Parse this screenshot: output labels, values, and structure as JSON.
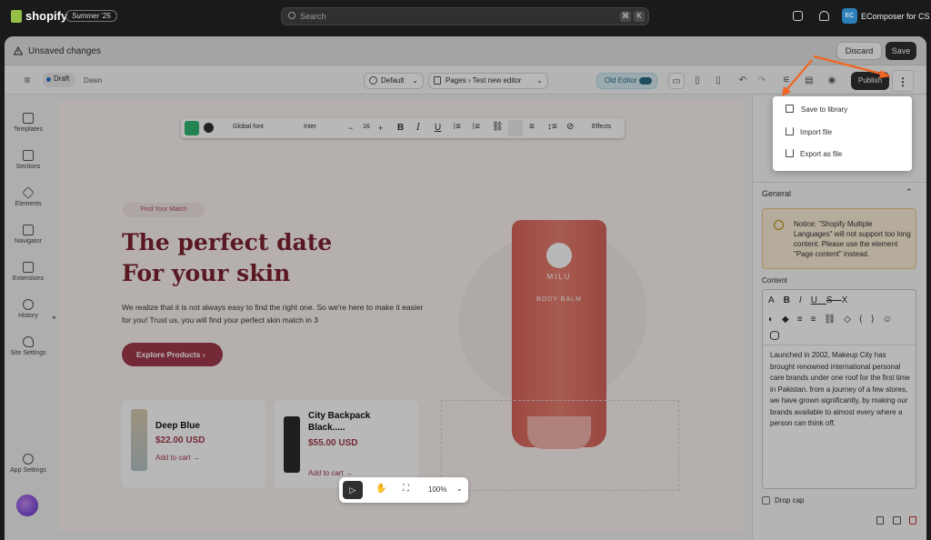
{
  "topbar": {
    "brand": "shopify",
    "edition": "Summer '25",
    "search_placeholder": "Search",
    "shortcut": [
      "⌘",
      "K"
    ],
    "store_initials": "EC",
    "store_name": "EComposer for CS"
  },
  "unsaved_bar": {
    "text": "Unsaved changes",
    "discard_label": "Discard",
    "save_label": "Save"
  },
  "editor_toolbar": {
    "status": "Draft",
    "theme": "Dawn",
    "template": "Default",
    "pages_label": "Pages",
    "page_name": "Test new editor",
    "old_editor_label": "Old Editor",
    "publish_label": "Publish"
  },
  "rail": {
    "items": [
      "Templates",
      "Sections",
      "Elements",
      "Navigator",
      "Extensions",
      "History",
      "Site Settings"
    ],
    "app_settings": "App Settings"
  },
  "format_bar": {
    "font_label": "Global font",
    "font_name": "Inter",
    "size": "16",
    "effects_label": "Effects"
  },
  "hero": {
    "tag": "Find Your Match",
    "heading_line1": "The perfect date",
    "heading_line2": "For your skin",
    "paragraph": "We realize that it is not always easy to find the right one. So we're here to make it easier for you! Trust us, you will find your perfect skin match in 3",
    "cta": "Explore Products ›",
    "product_brand": "MILU",
    "product_name": "BODY BALM"
  },
  "products": [
    {
      "name": "Deep Blue",
      "price": "$22.00 USD",
      "cta": "Add to cart →"
    },
    {
      "name": "City Backpack Black.....",
      "price": "$55.00 USD",
      "cta": "Add to cart →"
    }
  ],
  "bottom_toolbar": {
    "zoom": "100%"
  },
  "right_panel": {
    "section_label": "General",
    "notice": "Notice: \"Shopify Multiple Languages\" will not support too long content. Please use the element \"Page content\" instead.",
    "content_label": "Content",
    "content_text": "Launched in 2002, Makeup City has brought renowned international personal care brands under one roof for the first time in Pakistan. from a journey of a few stores, we have grown significantly, by making our brands available to almost every where a person can think off.",
    "dropcap_label": "Drop cap"
  },
  "more_menu": {
    "items": [
      "Save to library",
      "Import file",
      "Export as file"
    ]
  },
  "colors": {
    "accent_brand": "#a33a4c",
    "heading": "#7d2230",
    "annotation_arrow": "#f26522"
  }
}
